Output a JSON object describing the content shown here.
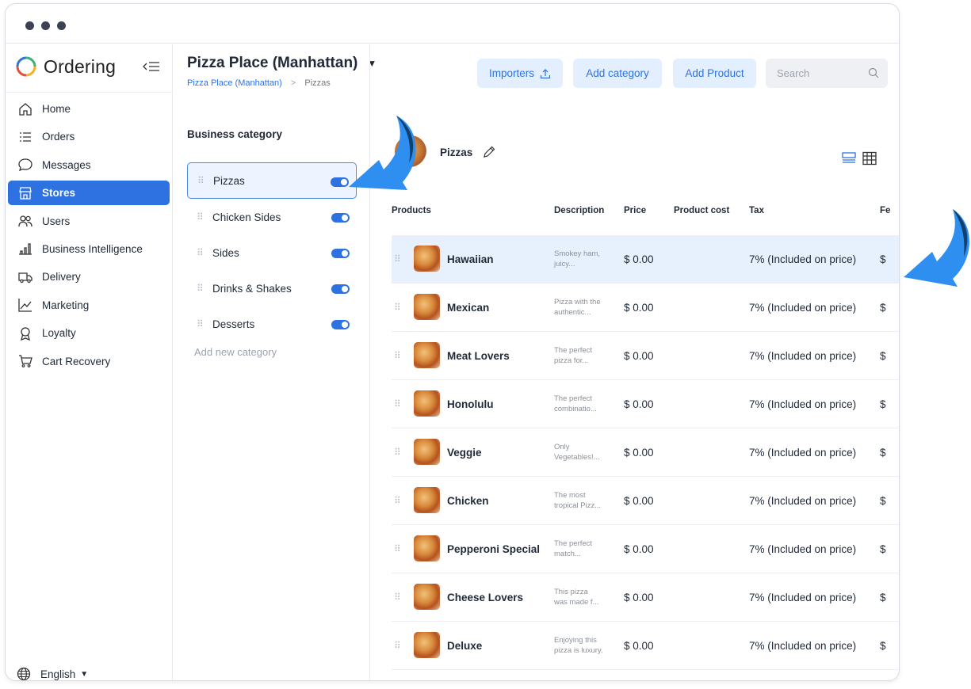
{
  "app": {
    "name": "Ordering"
  },
  "sidebar": {
    "items": [
      {
        "label": "Home",
        "icon": "home-icon",
        "active": false
      },
      {
        "label": "Orders",
        "icon": "orders-icon",
        "active": false
      },
      {
        "label": "Messages",
        "icon": "message-icon",
        "active": false
      },
      {
        "label": "Stores",
        "icon": "store-icon",
        "active": true
      },
      {
        "label": "Users",
        "icon": "users-icon",
        "active": false
      },
      {
        "label": "Business Intelligence",
        "icon": "bar-chart-icon",
        "active": false
      },
      {
        "label": "Delivery",
        "icon": "truck-icon",
        "active": false
      },
      {
        "label": "Marketing",
        "icon": "line-chart-icon",
        "active": false
      },
      {
        "label": "Loyalty",
        "icon": "award-icon",
        "active": false
      },
      {
        "label": "Cart Recovery",
        "icon": "cart-icon",
        "active": false
      }
    ],
    "language": "English"
  },
  "header": {
    "title": "Pizza Place (Manhattan)",
    "breadcrumb": {
      "parent": "Pizza Place (Manhattan)",
      "separator": ">",
      "current": "Pizzas"
    },
    "buttons": {
      "importers": "Importers",
      "add_category": "Add category",
      "add_product": "Add Product"
    },
    "search_placeholder": "Search"
  },
  "categories": {
    "heading": "Business category",
    "items": [
      {
        "label": "Pizzas",
        "enabled": true,
        "active": true
      },
      {
        "label": "Chicken Sides",
        "enabled": true,
        "active": false
      },
      {
        "label": "Sides",
        "enabled": true,
        "active": false
      },
      {
        "label": "Drinks & Shakes",
        "enabled": true,
        "active": false
      },
      {
        "label": "Desserts",
        "enabled": true,
        "active": false
      }
    ],
    "add_label": "Add new category"
  },
  "products": {
    "category_title": "Pizzas",
    "columns": {
      "products": "Products",
      "description": "Description",
      "price": "Price",
      "cost": "Product cost",
      "tax": "Tax",
      "fee": "Fe"
    },
    "rows": [
      {
        "name": "Hawaiian",
        "desc1": "Smokey ham,",
        "desc2": "juicy...",
        "price": "$ 0.00",
        "tax": "7% (Included on price)",
        "fee": "$"
      },
      {
        "name": "Mexican",
        "desc1": "Pizza with the",
        "desc2": "authentic...",
        "price": "$ 0.00",
        "tax": "7% (Included on price)",
        "fee": "$"
      },
      {
        "name": "Meat Lovers",
        "desc1": "The perfect",
        "desc2": "pizza for...",
        "price": "$ 0.00",
        "tax": "7% (Included on price)",
        "fee": "$"
      },
      {
        "name": "Honolulu",
        "desc1": "The perfect",
        "desc2": "combinatio...",
        "price": "$ 0.00",
        "tax": "7% (Included on price)",
        "fee": "$"
      },
      {
        "name": "Veggie",
        "desc1": "Only",
        "desc2": "Vegetables!...",
        "price": "$ 0.00",
        "tax": "7% (Included on price)",
        "fee": "$"
      },
      {
        "name": "Chicken",
        "desc1": "The most",
        "desc2": "tropical Pizz...",
        "price": "$ 0.00",
        "tax": "7% (Included on price)",
        "fee": "$"
      },
      {
        "name": "Pepperoni Special",
        "desc1": "The perfect",
        "desc2": "match...",
        "price": "$ 0.00",
        "tax": "7% (Included on price)",
        "fee": "$"
      },
      {
        "name": "Cheese Lovers",
        "desc1": "This pizza",
        "desc2": "was made f...",
        "price": "$ 0.00",
        "tax": "7% (Included on price)",
        "fee": "$"
      },
      {
        "name": "Deluxe",
        "desc1": "Enjoying this",
        "desc2": "pizza is luxury.",
        "price": "$ 0.00",
        "tax": "7% (Included on price)",
        "fee": "$"
      }
    ]
  },
  "colors": {
    "accent": "#2d72e0",
    "accent_light": "#e3efff",
    "arrow": "#2f8ff0",
    "arrow_dark": "#12406e"
  }
}
